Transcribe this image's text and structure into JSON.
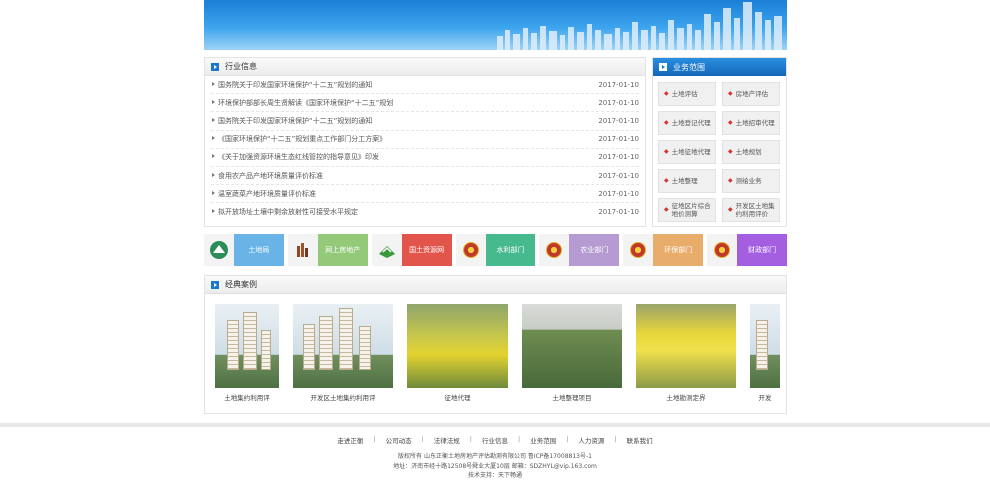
{
  "news": {
    "title": "行业信息",
    "items": [
      {
        "title": "国务院关于印发国家环境保护“十二五”规划的通知",
        "date": "2017-01-10"
      },
      {
        "title": "环境保护部部长周生贤解读《国家环境保护“十二五”规划",
        "date": "2017-01-10"
      },
      {
        "title": "国务院关于印发国家环境保护“十二五”规划的通知",
        "date": "2017-01-10"
      },
      {
        "title": "《国家环境保护“十二五”规划重点工作部门分工方案》",
        "date": "2017-01-10"
      },
      {
        "title": "《关于加强资源环境生态红线管控的指导意见》印发",
        "date": "2017-01-10"
      },
      {
        "title": "食用农产品产地环境质量评价标准",
        "date": "2017-01-10"
      },
      {
        "title": "温室蔬菜产地环境质量评价标准",
        "date": "2017-01-10"
      },
      {
        "title": "拟开放场址土壤中剩余放射性可接受水平规定",
        "date": "2017-01-10"
      }
    ]
  },
  "business": {
    "title": "业务范围",
    "items": [
      "土地评估",
      "房地产评估",
      "土地登记代理",
      "土地招审代理",
      "土地征地代理",
      "土地规划",
      "土地整理",
      "测绘业务",
      "征地区片综合地价测算",
      "开发区土地集约利用评价"
    ]
  },
  "links": [
    {
      "label": "土地局",
      "color": "#69b3e7"
    },
    {
      "label": "网上房地产",
      "color": "#94c97a"
    },
    {
      "label": "国土资源网",
      "color": "#e2554b"
    },
    {
      "label": "水利部门",
      "color": "#46b98e"
    },
    {
      "label": "农业部门",
      "color": "#b69bd2"
    },
    {
      "label": "环保部门",
      "color": "#e8ad6b"
    },
    {
      "label": "财政部门",
      "color": "#a45ee0"
    }
  ],
  "cases": {
    "title": "经典案例",
    "items": [
      {
        "caption": "土地集约利用评"
      },
      {
        "caption": "开发区土地集约利用评"
      },
      {
        "caption": "征地代理"
      },
      {
        "caption": "土地整理项目"
      },
      {
        "caption": "土地勘测定界"
      },
      {
        "caption": "开发"
      }
    ]
  },
  "footer": {
    "nav": [
      "走进正衡",
      "公司动态",
      "法律法规",
      "行业信息",
      "业务范围",
      "人力资源",
      "联系我们"
    ],
    "copyright": "版权所有 山东正衡土地房地产评估勘测有限公司 鲁ICP备17008813号-1",
    "address": "地址：济南市经十路12508号舜业大厦10层  邮箱：SDZHYL@vip.163.com",
    "support": "技术支持：天下畅通"
  },
  "colors": {
    "accent": "#1b78c9"
  }
}
